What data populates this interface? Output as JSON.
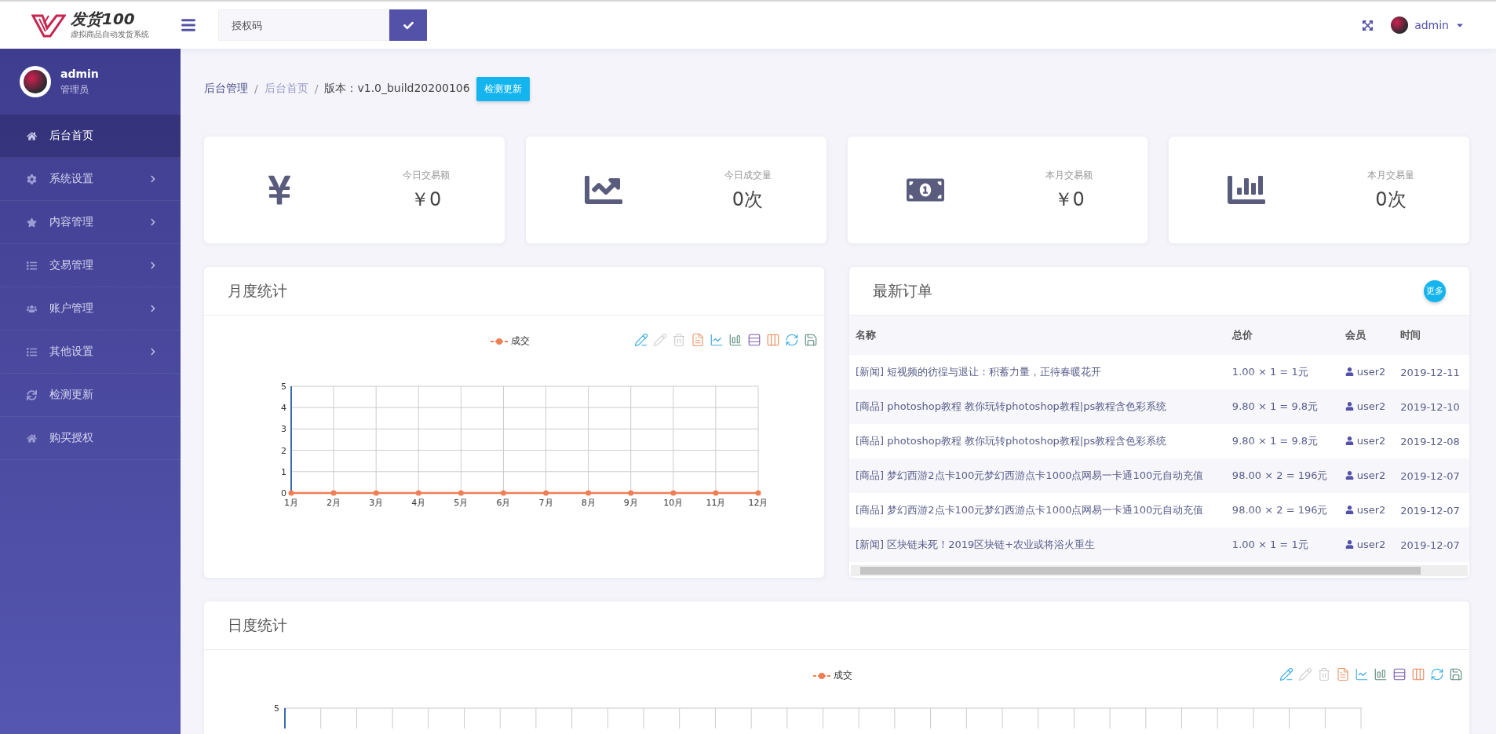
{
  "header": {
    "logo_text": "发货100",
    "logo_subtitle": "虚拟商品自动发货系统",
    "search": {
      "placeholder": "授权码"
    },
    "user": "admin"
  },
  "sidebar": {
    "user": {
      "name": "admin",
      "role": "管理员"
    },
    "items": [
      {
        "label": "后台首页",
        "selected": true,
        "has_submenu": false
      },
      {
        "label": "系统设置",
        "selected": false,
        "has_submenu": true
      },
      {
        "label": "内容管理",
        "selected": false,
        "has_submenu": true
      },
      {
        "label": "交易管理",
        "selected": false,
        "has_submenu": true
      },
      {
        "label": "账户管理",
        "selected": false,
        "has_submenu": true
      },
      {
        "label": "其他设置",
        "selected": false,
        "has_submenu": true
      },
      {
        "label": "检测更新",
        "selected": false,
        "has_submenu": false
      },
      {
        "label": "购买授权",
        "selected": false,
        "has_submenu": false
      }
    ]
  },
  "breadcrumb": {
    "separator": "/",
    "items": [
      {
        "label": "后台管理",
        "current": false
      },
      {
        "label": "后台首页",
        "current": true
      }
    ],
    "version": "版本：v1.0_build20200106",
    "button": "检测更新"
  },
  "stats": [
    {
      "label": "今日交易额",
      "value": "￥0"
    },
    {
      "label": "今日成交量",
      "value": "0次"
    },
    {
      "label": "本月交易额",
      "value": "￥0"
    },
    {
      "label": "本月交易量",
      "value": "0次"
    }
  ],
  "monthly": {
    "title": "月度统计",
    "chart_data": {
      "type": "line",
      "categories": [
        "1月",
        "2月",
        "3月",
        "4月",
        "5月",
        "6月",
        "7月",
        "8月",
        "9月",
        "10月",
        "11月",
        "12月"
      ],
      "series": [
        {
          "name": "成交",
          "color": "#ee7f55",
          "marker": "circle",
          "values": [
            0,
            0,
            0,
            0,
            0,
            0,
            0,
            0,
            0,
            0,
            0,
            0
          ]
        }
      ],
      "ylim": [
        0,
        5
      ],
      "yticks": [
        0,
        1,
        2,
        3,
        4,
        5
      ],
      "grid": true
    }
  },
  "orders": {
    "title": "最新订单",
    "more": "更多",
    "columns": [
      "名称",
      "总价",
      "会员",
      "时间"
    ],
    "rows": [
      {
        "name": "[新闻] 短视频的彷徨与退让：积蓄力量，正待春暖花开",
        "price": "1.00 × 1 = 1元",
        "member": "user2",
        "time": "2019-12-11"
      },
      {
        "name": "[商品] photoshop教程 教你玩转photoshop教程|ps教程含色彩系统",
        "price": "9.80 × 1 = 9.8元",
        "member": "user2",
        "time": "2019-12-10"
      },
      {
        "name": "[商品] photoshop教程 教你玩转photoshop教程|ps教程含色彩系统",
        "price": "9.80 × 1 = 9.8元",
        "member": "user2",
        "time": "2019-12-08"
      },
      {
        "name": "[商品] 梦幻西游2点卡100元梦幻西游点卡1000点网易一卡通100元自动充值",
        "price": "98.00 × 2 = 196元",
        "member": "user2",
        "time": "2019-12-07"
      },
      {
        "name": "[商品] 梦幻西游2点卡100元梦幻西游点卡1000点网易一卡通100元自动充值",
        "price": "98.00 × 2 = 196元",
        "member": "user2",
        "time": "2019-12-07"
      },
      {
        "name": "[新闻] 区块链未死！2019区块链+农业或将浴火重生",
        "price": "1.00 × 1 = 1元",
        "member": "user2",
        "time": "2019-12-07"
      }
    ]
  },
  "daily": {
    "title": "日度统计",
    "legend": "成交",
    "ytick_label": "5"
  }
}
